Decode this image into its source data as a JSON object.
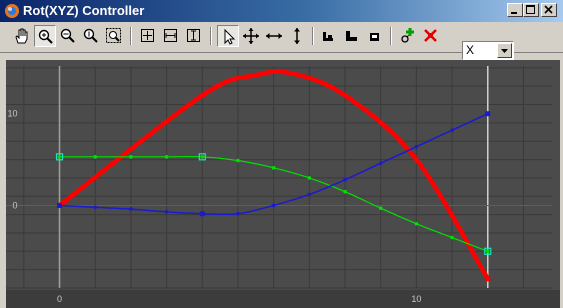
{
  "window": {
    "title": "Rot(XYZ) Controller",
    "controls": [
      "minimize",
      "maximize",
      "close"
    ]
  },
  "toolbar": {
    "tools": [
      {
        "name": "pan-icon",
        "pressed": false
      },
      {
        "name": "zoom-icon",
        "pressed": true
      },
      {
        "name": "zoom-horizontal-icon",
        "pressed": false
      },
      {
        "name": "zoom-vertical-icon",
        "pressed": false
      },
      {
        "name": "zoom-region-icon",
        "pressed": false
      },
      {
        "name": "zoom-extents-icon",
        "pressed": false
      },
      {
        "name": "zoom-extents-horizontal-icon",
        "pressed": false
      },
      {
        "name": "zoom-extents-vertical-icon",
        "pressed": false
      },
      {
        "name": "select-arrow-icon",
        "pressed": true
      },
      {
        "name": "move-icon",
        "pressed": false
      },
      {
        "name": "move-horizontal-icon",
        "pressed": false
      },
      {
        "name": "move-vertical-icon",
        "pressed": false
      },
      {
        "name": "tangent-in-icon",
        "pressed": false
      },
      {
        "name": "tangent-both-icon",
        "pressed": false
      },
      {
        "name": "tangent-out-icon",
        "pressed": false
      },
      {
        "name": "add-key-icon",
        "pressed": false
      },
      {
        "name": "delete-key-icon",
        "pressed": false
      }
    ],
    "axis_select": {
      "value": "X",
      "options": [
        "X"
      ]
    }
  },
  "colors": {
    "background": "#4b4b4b",
    "grid": "#3a3a3a",
    "zero_line": "#a0a0a0",
    "x_curve": "#ff0000",
    "y_curve": "#00e000",
    "z_curve": "#1a1ad0"
  },
  "chart_data": {
    "type": "line",
    "x_ticks": [
      "0",
      "10"
    ],
    "y_ticks": [
      "10",
      "0"
    ],
    "xlim": [
      -1.5,
      13.8
    ],
    "ylim": [
      -9,
      15.2
    ],
    "grid": true,
    "series": [
      {
        "color": "#ff0000",
        "x": [
          0,
          4,
          5.5,
          6.5,
          8,
          10,
          12
        ],
        "y": [
          0,
          12,
          14.2,
          14.4,
          12,
          5,
          -8
        ]
      },
      {
        "color": "#00e000",
        "x": [
          0,
          1,
          2,
          3,
          4,
          5,
          6,
          7,
          8,
          9,
          10,
          11,
          12
        ],
        "y": [
          5.3,
          5.3,
          5.3,
          5.3,
          5.3,
          4.9,
          4.1,
          3,
          1.5,
          -0.3,
          -2,
          -3.5,
          -5
        ]
      },
      {
        "color": "#1a1ad0",
        "x": [
          0,
          1,
          2,
          3,
          4,
          5,
          6,
          7,
          8,
          9,
          10,
          11,
          12
        ],
        "y": [
          0,
          -0.2,
          -0.4,
          -0.7,
          -0.9,
          -0.9,
          0,
          1.2,
          2.8,
          4.6,
          6.4,
          8.2,
          10
        ]
      }
    ],
    "keys": [
      {
        "series": 0,
        "x": [
          0,
          4,
          12
        ],
        "y": [
          0,
          12,
          -8
        ]
      },
      {
        "series": 1,
        "x": [
          0,
          4,
          12
        ],
        "y": [
          5.3,
          5.3,
          -5
        ]
      },
      {
        "series": 2,
        "x": [
          0,
          4,
          12
        ],
        "y": [
          0,
          -0.9,
          10
        ]
      }
    ]
  }
}
